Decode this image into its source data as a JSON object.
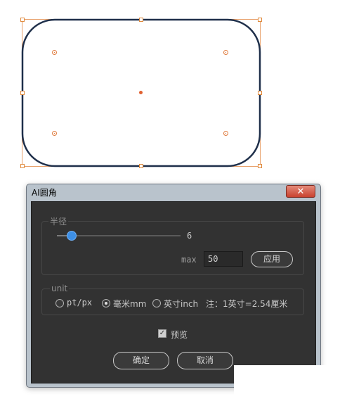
{
  "dialog": {
    "title": "AI圆角",
    "close_icon": "close-icon",
    "radius_group": {
      "label": "半径",
      "slider_value": "6",
      "slider_fraction": 0.12,
      "max_label": "max",
      "max_value": "50",
      "apply_label": "应用"
    },
    "unit_group": {
      "label": "unit",
      "options": [
        {
          "label": "pt/px",
          "selected": false
        },
        {
          "label": "毫米mm",
          "selected": true
        },
        {
          "label": "英寸inch",
          "selected": false
        }
      ],
      "note": "注：1英寸=2.54厘米"
    },
    "preview": {
      "label": "预览",
      "checked": true
    },
    "ok_label": "确定",
    "cancel_label": "取消"
  },
  "colors": {
    "shape_stroke": "#1f2f4a",
    "bounding_box": "#e08a3c",
    "slider_thumb": "#3d8fe6",
    "dialog_bg": "#323232",
    "close_button": "#c9422f"
  }
}
